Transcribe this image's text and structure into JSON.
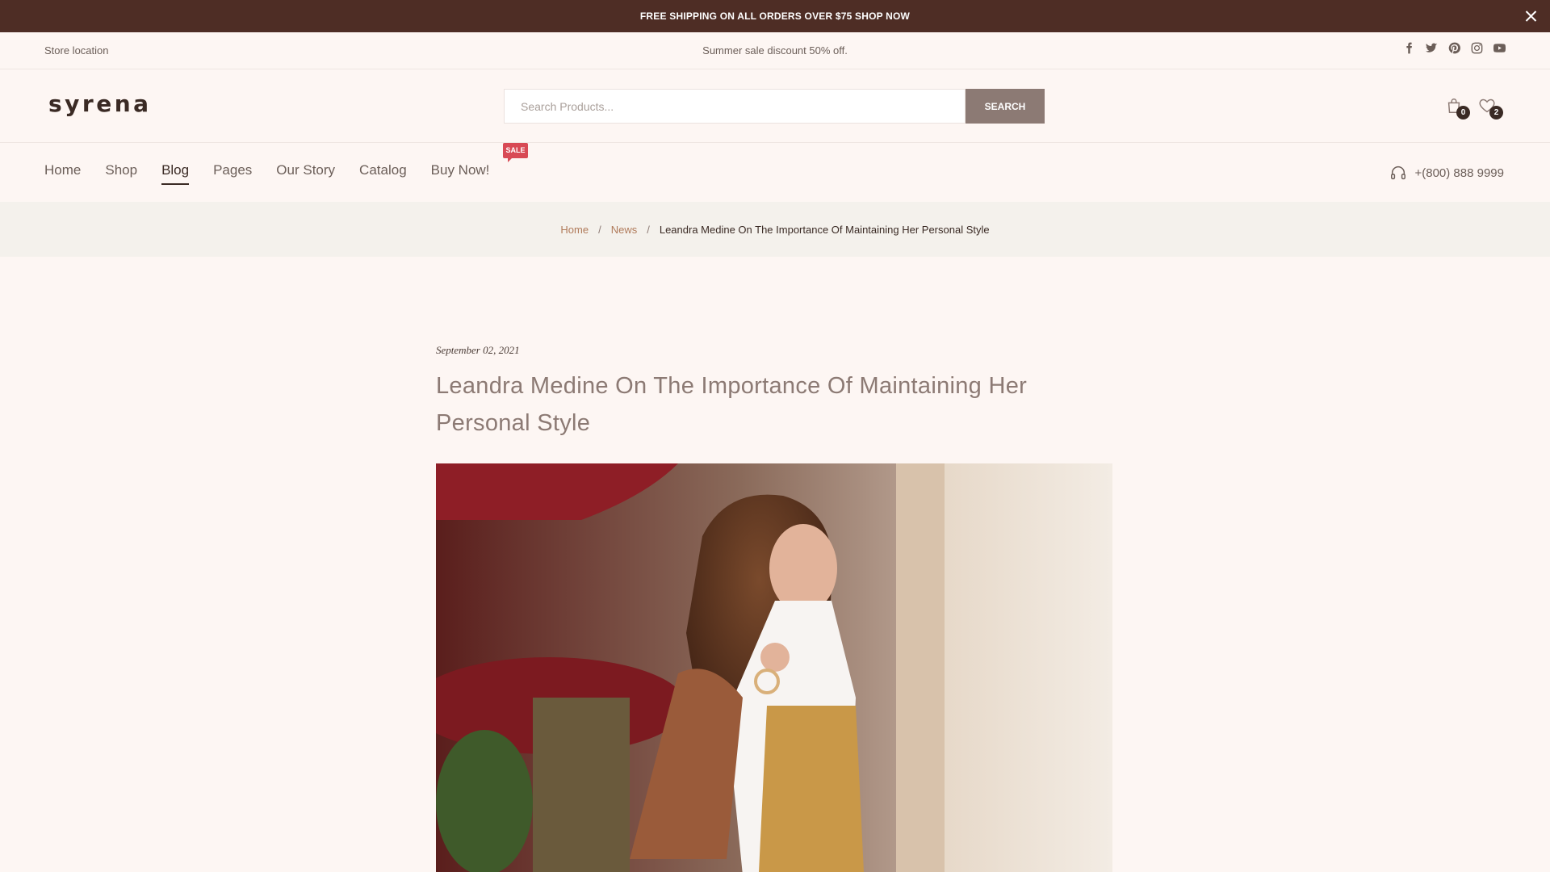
{
  "announcement": {
    "text": "FREE SHIPPING ON ALL ORDERS OVER $75 SHOP NOW"
  },
  "topbar": {
    "store_location": "Store location",
    "promo": "Summer sale discount 50% off.",
    "social": [
      "facebook-icon",
      "twitter-icon",
      "pinterest-icon",
      "instagram-icon",
      "youtube-icon"
    ]
  },
  "header": {
    "logo": "syrena",
    "search": {
      "placeholder": "Search Products...",
      "button_label": "SEARCH"
    },
    "cart_count": "0",
    "wishlist_count": "2"
  },
  "nav": {
    "items": [
      {
        "label": "Home"
      },
      {
        "label": "Shop"
      },
      {
        "label": "Blog",
        "active": true
      },
      {
        "label": "Pages"
      },
      {
        "label": "Our Story"
      },
      {
        "label": "Catalog"
      },
      {
        "label": "Buy Now!"
      }
    ],
    "sale_badge": "SALE",
    "phone": "+(800) 888 9999"
  },
  "breadcrumb": {
    "home": "Home",
    "news": "News",
    "separator": "/",
    "current": "Leandra Medine On The Importance Of Maintaining Her Personal Style"
  },
  "article": {
    "date": "September 02, 2021",
    "title": "Leandra Medine On The Importance Of Maintaining Her Personal Style"
  },
  "colors": {
    "announcement_bg": "#4e2d25",
    "page_bg": "#fdf6f3",
    "accent": "#8c7a74",
    "breadcrumb_bg": "#f4f1ec",
    "link": "#b07a5a",
    "sale_badge": "#d84a55"
  }
}
